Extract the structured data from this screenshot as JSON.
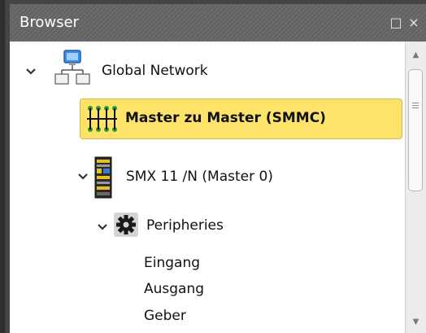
{
  "panel": {
    "title": "Browser",
    "maximize_glyph": "□",
    "close_glyph": "×"
  },
  "tree": {
    "global_network": {
      "label": "Global Network",
      "icon": "network-icon",
      "expanded": true
    },
    "master_link": {
      "label": "Master zu Master (SMMC)",
      "icon": "bus-topology-icon",
      "selected": true
    },
    "device": {
      "label": "SMX 11 /N (Master 0)",
      "icon": "device-module-icon",
      "expanded": true
    },
    "peripheries": {
      "label": "Peripheries",
      "icon": "gear-icon",
      "expanded": true
    },
    "children": [
      {
        "label": "Eingang"
      },
      {
        "label": "Ausgang"
      },
      {
        "label": "Geber"
      }
    ]
  },
  "colors": {
    "selection": "#fde36a",
    "title_bar": "#666666"
  }
}
